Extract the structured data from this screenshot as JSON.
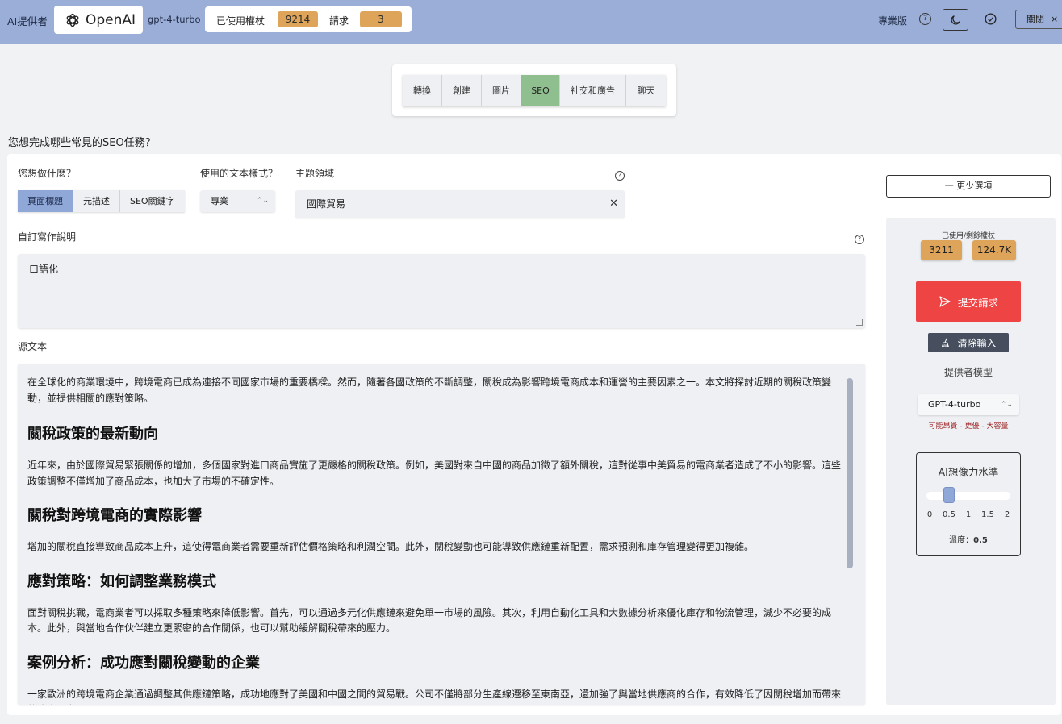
{
  "header": {
    "provider_label": "AI提供者",
    "provider_name": "OpenAI",
    "model": "gpt-4-turbo",
    "used_tokens_label": "已使用權杖",
    "used_tokens": "9214",
    "requests_label": "請求",
    "requests": "3",
    "pro_label": "專業版",
    "close_label": "關閉",
    "close_x": "×"
  },
  "tabs": [
    {
      "label": "轉換",
      "active": false
    },
    {
      "label": "創建",
      "active": false
    },
    {
      "label": "圖片",
      "active": false
    },
    {
      "label": "SEO",
      "active": true
    },
    {
      "label": "社交和廣告",
      "active": false
    },
    {
      "label": "聊天",
      "active": false
    }
  ],
  "question": "您想完成哪些常見的SEO任務？",
  "form": {
    "what_label": "您想做什麼？",
    "what_options": [
      {
        "label": "頁面標題",
        "active": true
      },
      {
        "label": "元描述",
        "active": false
      },
      {
        "label": "SEO關鍵字",
        "active": false
      }
    ],
    "style_label": "使用的文本樣式？",
    "style_value": "專業",
    "topic_label": "主題領域",
    "topic_value": "國際貿易",
    "custom_label": "自訂寫作說明",
    "custom_value": "口語化",
    "source_label": "源文本",
    "source": [
      {
        "type": "p",
        "text": "在全球化的商業環境中，跨境電商已成為連接不同國家市場的重要橋樑。然而，隨著各國政策的不斷調整，關稅成為影響跨境電商成本和運營的主要因素之一。本文將探討近期的關稅政策變動，並提供相關的應對策略。"
      },
      {
        "type": "h",
        "text": "關稅政策的最新動向"
      },
      {
        "type": "p",
        "text": "近年來，由於國際貿易緊張關係的增加，多個國家對進口商品實施了更嚴格的關稅政策。例如，美國對來自中國的商品加徵了額外關稅，這對從事中美貿易的電商業者造成了不小的影響。這些政策調整不僅增加了商品成本，也加大了市場的不確定性。"
      },
      {
        "type": "h",
        "text": "關稅對跨境電商的實際影響"
      },
      {
        "type": "p",
        "text": "增加的關稅直接導致商品成本上升，這使得電商業者需要重新評估價格策略和利潤空間。此外，關稅變動也可能導致供應鏈重新配置，需求預測和庫存管理變得更加複雜。"
      },
      {
        "type": "h",
        "text": "應對策略：如何調整業務模式"
      },
      {
        "type": "p",
        "text": "面對關稅挑戰，電商業者可以採取多種策略來降低影響。首先，可以通過多元化供應鏈來避免單一市場的風險。其次，利用自動化工具和大數據分析來優化庫存和物流管理，減少不必要的成本。此外，與當地合作伙伴建立更緊密的合作關係，也可以幫助緩解關稅帶來的壓力。"
      },
      {
        "type": "h",
        "text": "案例分析：成功應對關稅變動的企業"
      },
      {
        "type": "p",
        "text": "一家歐洲的跨境電商企業通過調整其供應鏈策略，成功地應對了美國和中國之間的貿易戰。公司不僅將部分生產線遷移至東南亞，還加強了與當地供應商的合作，有效降低了因關稅增加而帶來的成本壓力。"
      }
    ]
  },
  "sidebar": {
    "less_options": "一  更少選項",
    "used_remaining_label": "已使用/剩餘權杖",
    "used": "3211",
    "remaining": "124.7K",
    "submit": "提交請求",
    "clear": "清除輸入",
    "provider_model_label": "提供者模型",
    "model_value": "GPT-4-turbo",
    "warning": "可能昂貴 - 更優 - 大容量",
    "imagination_label": "AI想像力水準",
    "ticks": [
      "0",
      "0.5",
      "1",
      "1.5",
      "2"
    ],
    "temperature_label": "溫度：",
    "temperature": "0.5",
    "slider_min": 0,
    "slider_max": 2
  },
  "colors": {
    "topbar": "#9aaed8",
    "accent_active_tab": "#8fbf8f",
    "accent_option": "#8fa8d8",
    "badge": "#dea55a",
    "submit": "#ee4444"
  }
}
